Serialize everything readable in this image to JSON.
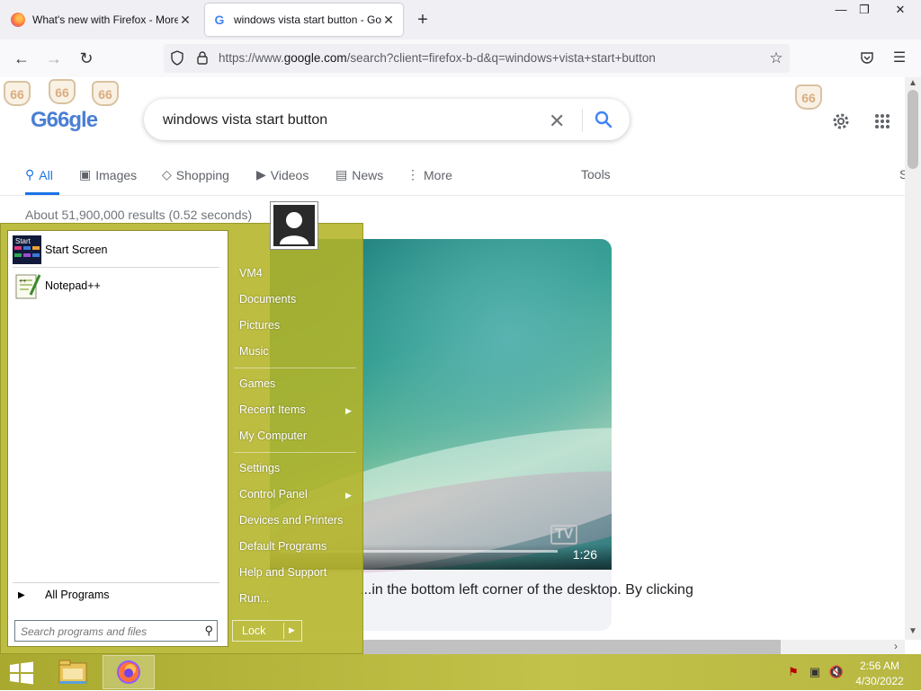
{
  "browser": {
    "tabs": [
      {
        "title": "What's new with Firefox - More",
        "favicon": "firefox-icon",
        "active": false
      },
      {
        "title": "windows vista start button - Go",
        "favicon": "google-icon",
        "active": true
      }
    ],
    "new_tab": "+",
    "window_controls": {
      "minimize": "—",
      "restore": "❐",
      "close": "✕"
    },
    "url_prefix": "https://www.",
    "url_host": "google.com",
    "url_rest": "/search?client=firefox-b-d&q=windows+vista+start+button"
  },
  "google": {
    "logo_text": "G66gle",
    "badge": "66",
    "query": "windows vista start button",
    "tabs": [
      {
        "label": "All",
        "icon": "search-icon",
        "active": true
      },
      {
        "label": "Images",
        "icon": "image-icon"
      },
      {
        "label": "Shopping",
        "icon": "tag-icon"
      },
      {
        "label": "Videos",
        "icon": "play-icon"
      },
      {
        "label": "News",
        "icon": "news-icon"
      },
      {
        "label": "More",
        "icon": "more-vert-icon"
      }
    ],
    "tools": "Tools",
    "cut_label": "S",
    "stats": "About 51,900,000 results (0.52 seconds)",
    "video": {
      "duration": "1:26",
      "watermark": "TV"
    },
    "snippet": "...in the bottom left corner of the desktop. By clicking"
  },
  "start_menu": {
    "programs": [
      {
        "label": "Start Screen",
        "icon": "start-screen-icon"
      },
      {
        "label": "Notepad++",
        "icon": "notepadpp-icon"
      }
    ],
    "all_programs": "All Programs",
    "search_placeholder": "Search programs and files",
    "right_items": [
      {
        "label": "VM4"
      },
      {
        "label": "Documents"
      },
      {
        "label": "Pictures"
      },
      {
        "label": "Music"
      },
      {
        "label": "Games"
      },
      {
        "label": "Recent Items",
        "submenu": true
      },
      {
        "label": "My Computer"
      },
      {
        "label": "Settings"
      },
      {
        "label": "Control Panel",
        "submenu": true
      },
      {
        "label": "Devices and Printers"
      },
      {
        "label": "Default Programs"
      },
      {
        "label": "Help and Support"
      },
      {
        "label": "Run..."
      }
    ],
    "lock": "Lock"
  },
  "taskbar": {
    "clock_time": "2:56 AM",
    "clock_date": "4/30/2022"
  },
  "colors": {
    "accent": "#1a73e8",
    "start_menu": "#b4b428",
    "taskbar": "#b7b742"
  }
}
